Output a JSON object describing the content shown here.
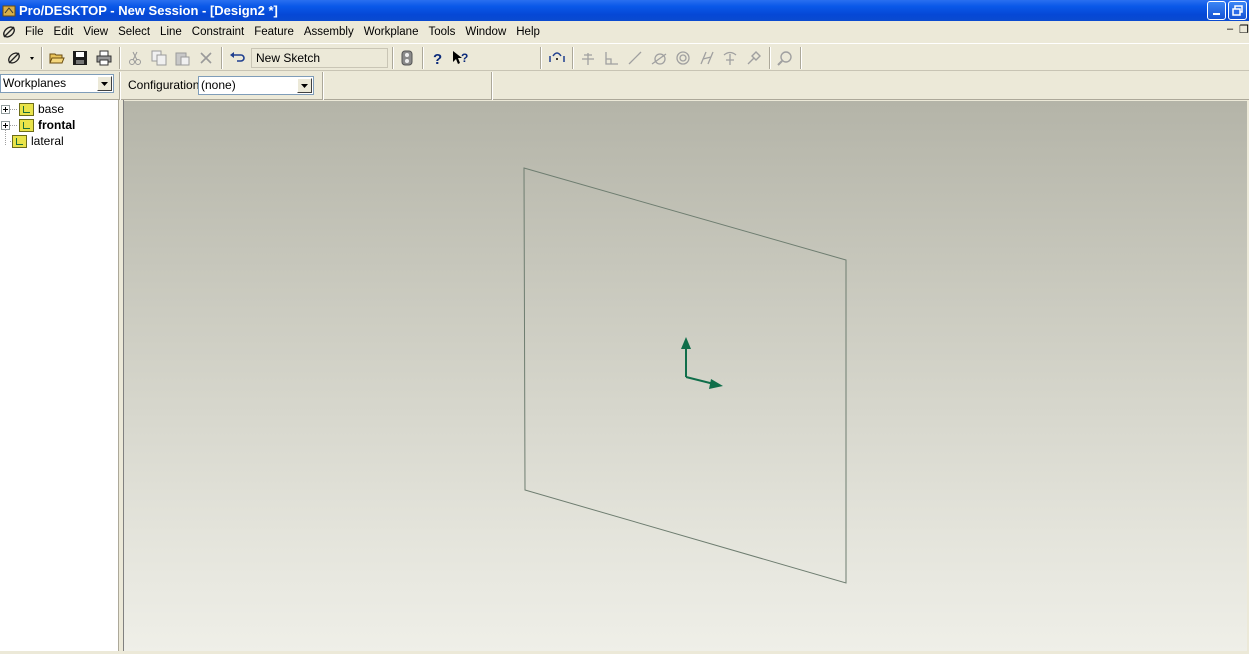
{
  "window": {
    "title": "Pro/DESKTOP - New Session - [Design2 *]"
  },
  "menu": {
    "items": [
      "File",
      "Edit",
      "View",
      "Select",
      "Line",
      "Constraint",
      "Feature",
      "Assembly",
      "Workplane",
      "Tools",
      "Window",
      "Help"
    ]
  },
  "toolbar": {
    "sketch_value": "New Sketch",
    "icons": [
      "browser-icon",
      "open-icon",
      "save-icon",
      "print-icon",
      "cut-icon",
      "copy-icon",
      "paste-icon",
      "delete-icon",
      "undo-icon",
      "sketch-toggle-icon",
      "help-icon",
      "whats-this-icon",
      "line-tool-icon",
      "constraint-icon",
      "perpendicular-icon",
      "parallel-icon",
      "tangent-icon",
      "concentric-icon",
      "equal-icon",
      "mirror-icon",
      "fix-icon",
      "zoom-icon"
    ]
  },
  "browser": {
    "selector_value": "Workplanes",
    "items": [
      {
        "label": "base",
        "bold": false,
        "expandable": true
      },
      {
        "label": "frontal",
        "bold": true,
        "expandable": true
      },
      {
        "label": "lateral",
        "bold": false,
        "expandable": false
      }
    ]
  },
  "configuration": {
    "label": "Configuration:",
    "value": "(none)"
  },
  "colors": {
    "titlebar": "#0548d6",
    "axis_arrows": "#0f6e4a",
    "workplane_outline": "#6e7d70"
  }
}
